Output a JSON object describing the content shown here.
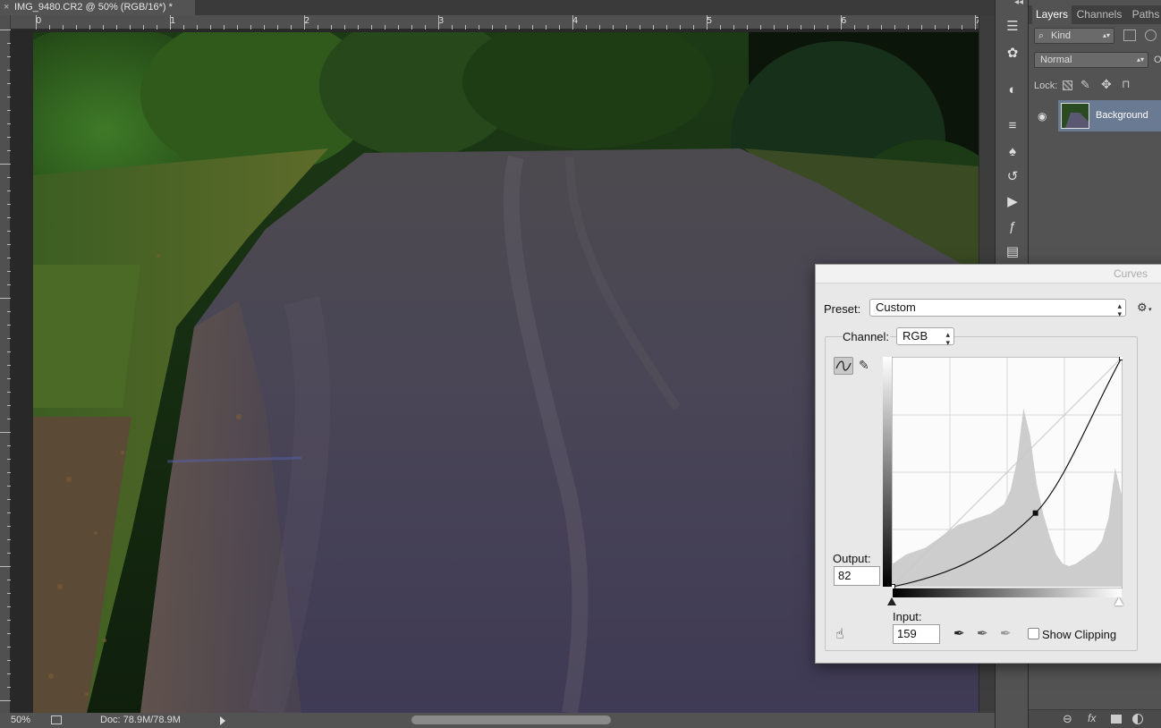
{
  "document": {
    "tab_title": "IMG_9480.CR2 @ 50% (RGB/16*) *",
    "close_glyph": "×"
  },
  "ruler": {
    "top_labels": [
      "0",
      "1",
      "2",
      "3",
      "4",
      "5",
      "6",
      "7"
    ]
  },
  "status_bar": {
    "zoom": "50%",
    "doc_info": "Doc: 78.9M/78.9M"
  },
  "toolstrip": {
    "collapse": "◂◂",
    "icons": [
      "layer-comps-icon",
      "brush-presets-icon",
      "adjustments-icon",
      "properties-icon",
      "clone-source-icon",
      "history-icon",
      "actions-icon",
      "styles-icon",
      "libraries-icon"
    ]
  },
  "layers_panel": {
    "tabs": [
      "Layers",
      "Channels",
      "Paths"
    ],
    "filter_kind": "Kind",
    "blend_mode": "Normal",
    "opacity_abbrev": "O",
    "lock_label": "Lock:",
    "layer_name": "Background",
    "bottom_icons": [
      "link-icon",
      "fx-icon",
      "mask-icon",
      "adjustment-layer-icon"
    ]
  },
  "curves_dialog": {
    "title": "Curves",
    "preset_label": "Preset:",
    "preset_value": "Custom",
    "channel_label": "Channel:",
    "channel_value": "RGB",
    "output_label": "Output:",
    "output_value": "82",
    "input_label": "Input:",
    "input_value": "159",
    "show_clipping_label": "Show Clipping",
    "show_clipping_checked": false,
    "curve_points": [
      [
        0,
        0
      ],
      [
        159,
        82
      ],
      [
        255,
        255
      ]
    ],
    "colors": {
      "curve": "#111111",
      "histogram": "#cdcdcd",
      "grid": "#d8d8d8",
      "background": "#e8e8e8"
    }
  }
}
